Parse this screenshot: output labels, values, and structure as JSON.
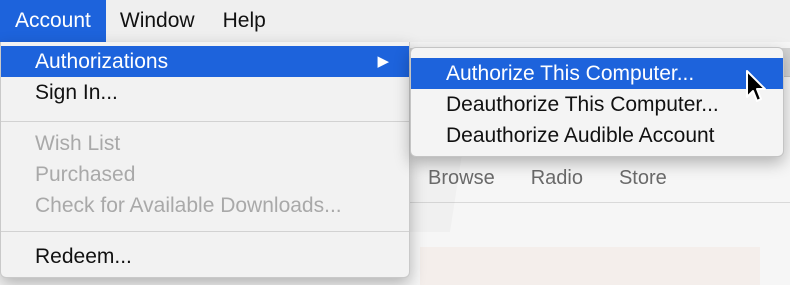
{
  "menubar": {
    "items": [
      "Account",
      "Window",
      "Help"
    ]
  },
  "account_menu": {
    "authorizations": "Authorizations",
    "sign_in": "Sign In...",
    "wish_list": "Wish List",
    "purchased": "Purchased",
    "check_downloads": "Check for Available Downloads...",
    "redeem": "Redeem..."
  },
  "submenu": {
    "authorize": "Authorize This Computer...",
    "deauthorize": "Deauthorize This Computer...",
    "deauthorize_audible": "Deauthorize Audible Account"
  },
  "app": {
    "tabs": [
      "Browse",
      "Radio",
      "Store"
    ]
  },
  "colors": {
    "highlight": "#1d63dc",
    "disabled_text": "#a9a9a9"
  }
}
